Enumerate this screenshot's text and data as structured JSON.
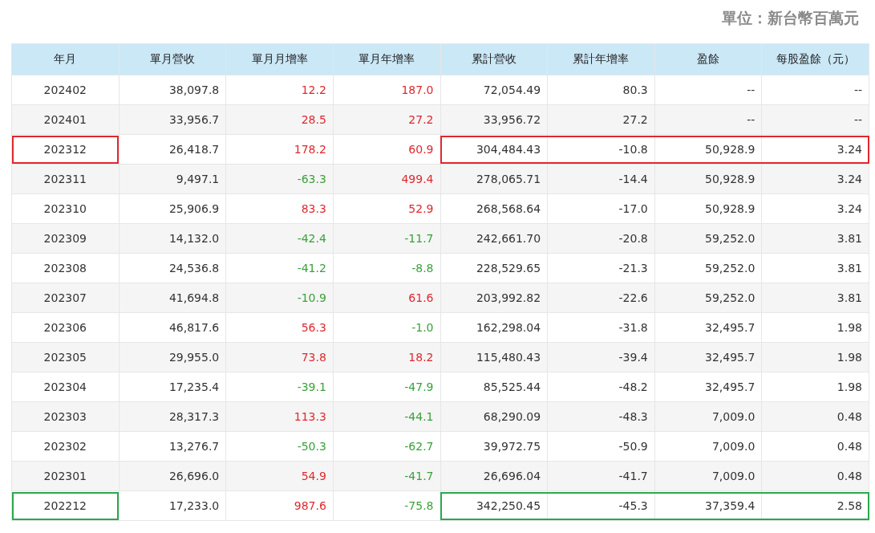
{
  "unit_label": "單位：新台幣百萬元",
  "table": {
    "columns": [
      "年月",
      "單月營收",
      "單月月增率",
      "單月年增率",
      "累計營收",
      "累計年增率",
      "盈餘",
      "每股盈餘（元）"
    ],
    "rows": [
      {
        "month": "202402",
        "revenue": "38,097.8",
        "mom": {
          "text": "12.2",
          "rising": true
        },
        "yoy": {
          "text": "187.0",
          "rising": true
        },
        "cum_revenue": "72,054.49",
        "cum_yoy": "80.3",
        "earnings": "--",
        "eps": "--"
      },
      {
        "month": "202401",
        "revenue": "33,956.7",
        "mom": {
          "text": "28.5",
          "rising": true
        },
        "yoy": {
          "text": "27.2",
          "rising": true
        },
        "cum_revenue": "33,956.72",
        "cum_yoy": "27.2",
        "earnings": "--",
        "eps": "--"
      },
      {
        "month": "202312",
        "revenue": "26,418.7",
        "mom": {
          "text": "178.2",
          "rising": true
        },
        "yoy": {
          "text": "60.9",
          "rising": true
        },
        "cum_revenue": "304,484.43",
        "cum_yoy": "-10.8",
        "earnings": "50,928.9",
        "eps": "3.24",
        "color": "#e0282e"
      },
      {
        "month": "202311",
        "revenue": "9,497.1",
        "mom": {
          "text": "-63.3",
          "rising": false
        },
        "yoy": {
          "text": "499.4",
          "rising": true
        },
        "cum_revenue": "278,065.71",
        "cum_yoy": "-14.4",
        "earnings": "50,928.9",
        "eps": "3.24"
      },
      {
        "month": "202310",
        "revenue": "25,906.9",
        "mom": {
          "text": "83.3",
          "rising": true
        },
        "yoy": {
          "text": "52.9",
          "rising": true
        },
        "cum_revenue": "268,568.64",
        "cum_yoy": "-17.0",
        "earnings": "50,928.9",
        "eps": "3.24"
      },
      {
        "month": "202309",
        "revenue": "14,132.0",
        "mom": {
          "text": "-42.4",
          "rising": false
        },
        "yoy": {
          "text": "-11.7",
          "rising": false
        },
        "cum_revenue": "242,661.70",
        "cum_yoy": "-20.8",
        "earnings": "59,252.0",
        "eps": "3.81"
      },
      {
        "month": "202308",
        "revenue": "24,536.8",
        "mom": {
          "text": "-41.2",
          "rising": false
        },
        "yoy": {
          "text": "-8.8",
          "rising": false
        },
        "cum_revenue": "228,529.65",
        "cum_yoy": "-21.3",
        "earnings": "59,252.0",
        "eps": "3.81"
      },
      {
        "month": "202307",
        "revenue": "41,694.8",
        "mom": {
          "text": "-10.9",
          "rising": false
        },
        "yoy": {
          "text": "61.6",
          "rising": true
        },
        "cum_revenue": "203,992.82",
        "cum_yoy": "-22.6",
        "earnings": "59,252.0",
        "eps": "3.81"
      },
      {
        "month": "202306",
        "revenue": "46,817.6",
        "mom": {
          "text": "56.3",
          "rising": true
        },
        "yoy": {
          "text": "-1.0",
          "rising": false
        },
        "cum_revenue": "162,298.04",
        "cum_yoy": "-31.8",
        "earnings": "32,495.7",
        "eps": "1.98"
      },
      {
        "month": "202305",
        "revenue": "29,955.0",
        "mom": {
          "text": "73.8",
          "rising": true
        },
        "yoy": {
          "text": "18.2",
          "rising": true
        },
        "cum_revenue": "115,480.43",
        "cum_yoy": "-39.4",
        "earnings": "32,495.7",
        "eps": "1.98"
      },
      {
        "month": "202304",
        "revenue": "17,235.4",
        "mom": {
          "text": "-39.1",
          "rising": false
        },
        "yoy": {
          "text": "-47.9",
          "rising": false
        },
        "cum_revenue": "85,525.44",
        "cum_yoy": "-48.2",
        "earnings": "32,495.7",
        "eps": "1.98"
      },
      {
        "month": "202303",
        "revenue": "28,317.3",
        "mom": {
          "text": "113.3",
          "rising": true
        },
        "yoy": {
          "text": "-44.1",
          "rising": false
        },
        "cum_revenue": "68,290.09",
        "cum_yoy": "-48.3",
        "earnings": "7,009.0",
        "eps": "0.48"
      },
      {
        "month": "202302",
        "revenue": "13,276.7",
        "mom": {
          "text": "-50.3",
          "rising": false
        },
        "yoy": {
          "text": "-62.7",
          "rising": false
        },
        "cum_revenue": "39,972.75",
        "cum_yoy": "-50.9",
        "earnings": "7,009.0",
        "eps": "0.48"
      },
      {
        "month": "202301",
        "revenue": "26,696.0",
        "mom": {
          "text": "54.9",
          "rising": true
        },
        "yoy": {
          "text": "-41.7",
          "rising": false
        },
        "cum_revenue": "26,696.04",
        "cum_yoy": "-41.7",
        "earnings": "7,009.0",
        "eps": "0.48"
      },
      {
        "month": "202212",
        "revenue": "17,233.0",
        "mom": {
          "text": "987.6",
          "rising": true
        },
        "yoy": {
          "text": "-75.8",
          "rising": false
        },
        "cum_revenue": "342,250.45",
        "cum_yoy": "-45.3",
        "earnings": "37,359.4",
        "eps": "2.58",
        "color": "#2aa84a"
      }
    ]
  }
}
